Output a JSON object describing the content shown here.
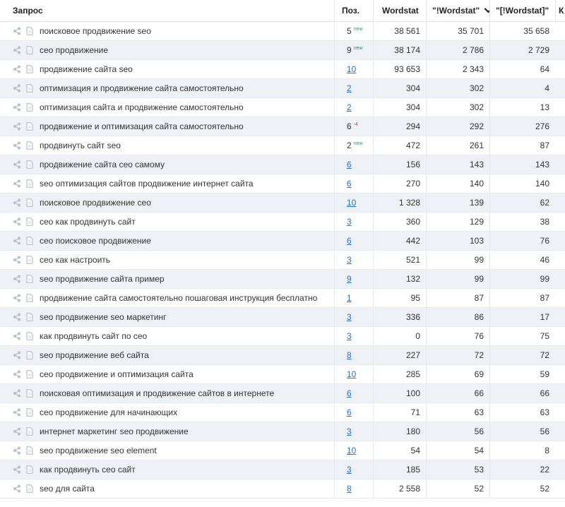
{
  "header": {
    "query": "Запрос",
    "pos": "Поз.",
    "wordstat": "Wordstat",
    "wordstat2": "\"!Wordstat\"",
    "wordstat3": "\"[!Wordstat]\"",
    "k": "К"
  },
  "rows": [
    {
      "query": "поисковое продвижение seo",
      "pos": "5",
      "badge": "new",
      "ws": "38 561",
      "ws2": "35 701",
      "ws3": "35 658"
    },
    {
      "query": "сео продвижение",
      "pos": "9",
      "badge": "new",
      "ws": "38 174",
      "ws2": "2 786",
      "ws3": "2 729"
    },
    {
      "query": "продвижение сайта seo",
      "pos": "10",
      "badge": "",
      "ws": "93 653",
      "ws2": "2 343",
      "ws3": "64"
    },
    {
      "query": "оптимизация и продвижение сайта самостоятельно",
      "pos": "2",
      "badge": "",
      "ws": "304",
      "ws2": "302",
      "ws3": "4"
    },
    {
      "query": "оптимизация сайта и продвижение самостоятельно",
      "pos": "2",
      "badge": "",
      "ws": "304",
      "ws2": "302",
      "ws3": "13"
    },
    {
      "query": "продвижение и оптимизация сайта самостоятельно",
      "pos": "6",
      "badge": "-4",
      "ws": "294",
      "ws2": "292",
      "ws3": "276"
    },
    {
      "query": "продвинуть сайт seo",
      "pos": "2",
      "badge": "new",
      "ws": "472",
      "ws2": "261",
      "ws3": "87"
    },
    {
      "query": "продвижение сайта сео самому",
      "pos": "6",
      "badge": "",
      "ws": "156",
      "ws2": "143",
      "ws3": "143"
    },
    {
      "query": "seo оптимизация сайтов продвижение интернет сайта",
      "pos": "6",
      "badge": "",
      "ws": "270",
      "ws2": "140",
      "ws3": "140"
    },
    {
      "query": "поисковое продвижение сео",
      "pos": "10",
      "badge": "",
      "ws": "1 328",
      "ws2": "139",
      "ws3": "62"
    },
    {
      "query": "сео как продвинуть сайт",
      "pos": "3",
      "badge": "",
      "ws": "360",
      "ws2": "129",
      "ws3": "38"
    },
    {
      "query": "сео поисковое продвижение",
      "pos": "6",
      "badge": "",
      "ws": "442",
      "ws2": "103",
      "ws3": "76"
    },
    {
      "query": "сео как настроить",
      "pos": "3",
      "badge": "",
      "ws": "521",
      "ws2": "99",
      "ws3": "46"
    },
    {
      "query": "seo продвижение сайта пример",
      "pos": "9",
      "badge": "",
      "ws": "132",
      "ws2": "99",
      "ws3": "99"
    },
    {
      "query": "продвижение сайта самостоятельно пошаговая инструкция бесплатно",
      "pos": "1",
      "badge": "",
      "ws": "95",
      "ws2": "87",
      "ws3": "87"
    },
    {
      "query": "seo продвижение seo маркетинг",
      "pos": "3",
      "badge": "",
      "ws": "336",
      "ws2": "86",
      "ws3": "17"
    },
    {
      "query": "как продвинуть сайт по сео",
      "pos": "3",
      "badge": "",
      "ws": "0",
      "ws2": "76",
      "ws3": "75"
    },
    {
      "query": "seo продвижение веб сайта",
      "pos": "8",
      "badge": "",
      "ws": "227",
      "ws2": "72",
      "ws3": "72"
    },
    {
      "query": "сео продвижение и оптимизация сайта",
      "pos": "10",
      "badge": "",
      "ws": "285",
      "ws2": "69",
      "ws3": "59"
    },
    {
      "query": "поисковая оптимизация и продвижение сайтов в интернете",
      "pos": "6",
      "badge": "",
      "ws": "100",
      "ws2": "66",
      "ws3": "66"
    },
    {
      "query": "сео продвижение для начинающих",
      "pos": "6",
      "badge": "",
      "ws": "71",
      "ws2": "63",
      "ws3": "63"
    },
    {
      "query": "интернет маркетинг seo продвижение",
      "pos": "3",
      "badge": "",
      "ws": "180",
      "ws2": "56",
      "ws3": "56"
    },
    {
      "query": "seo продвижение seo element",
      "pos": "10",
      "badge": "",
      "ws": "54",
      "ws2": "54",
      "ws3": "8"
    },
    {
      "query": "как продвинуть сео сайт",
      "pos": "3",
      "badge": "",
      "ws": "185",
      "ws2": "53",
      "ws3": "22"
    },
    {
      "query": "seo для сайта",
      "pos": "8",
      "badge": "",
      "ws": "2 558",
      "ws2": "52",
      "ws3": "52"
    }
  ],
  "icons": {
    "share": "share-icon",
    "doc": "document-icon",
    "sort": "chevron-down-icon"
  },
  "colors": {
    "link": "#2a6fc9",
    "badge_new": "#1aa36b",
    "badge_neg": "#e0342c",
    "row_alt": "#eef1f5"
  }
}
